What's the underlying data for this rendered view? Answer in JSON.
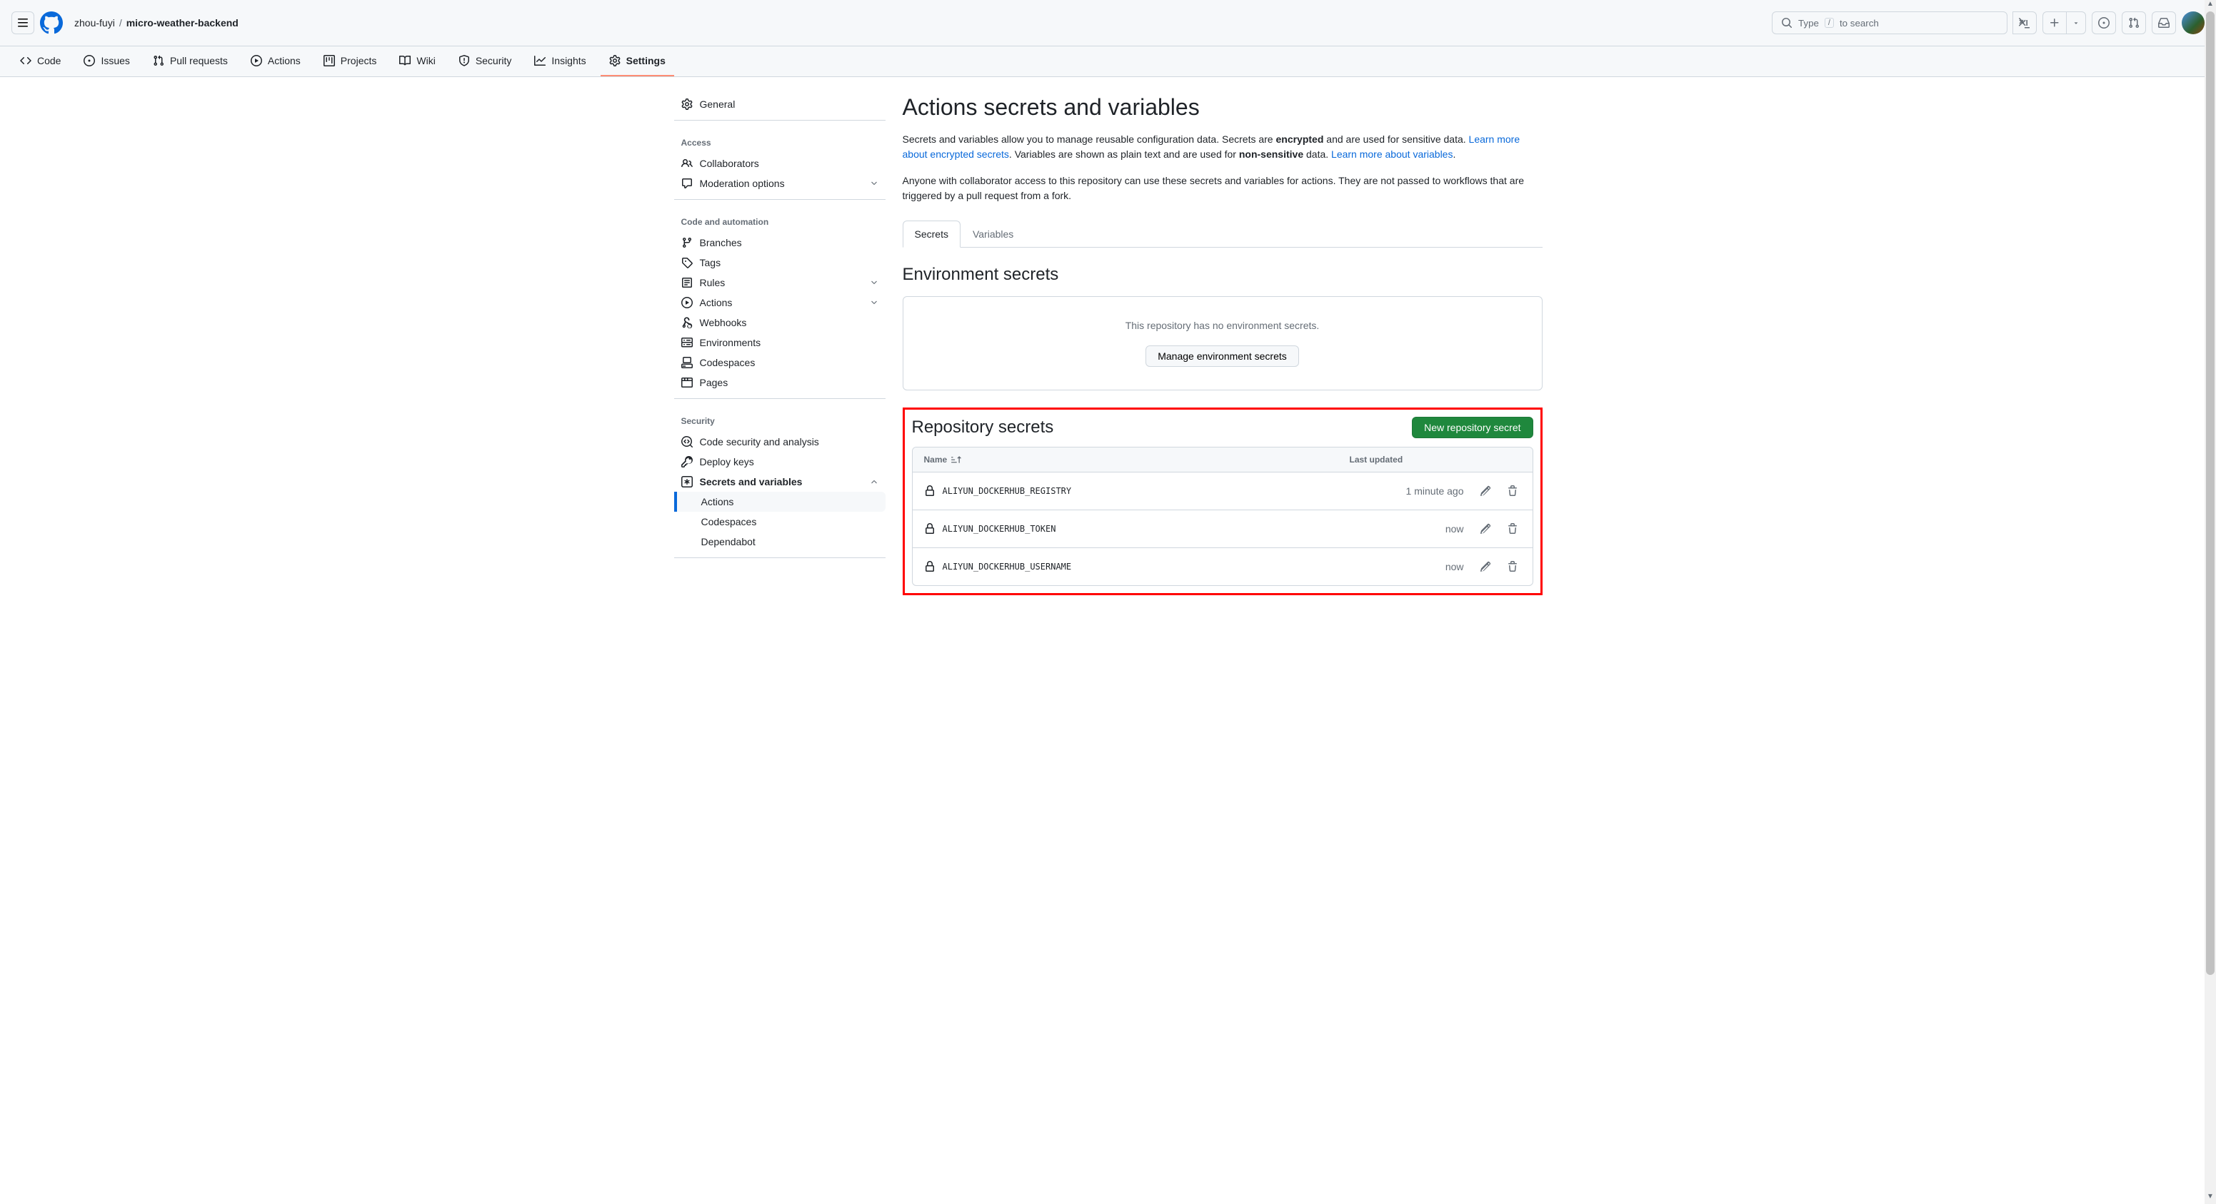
{
  "header": {
    "owner": "zhou-fuyi",
    "repo": "micro-weather-backend",
    "search_prefix": "Type",
    "search_key": "/",
    "search_suffix": "to search"
  },
  "repo_nav": {
    "code": "Code",
    "issues": "Issues",
    "pulls": "Pull requests",
    "actions": "Actions",
    "projects": "Projects",
    "wiki": "Wiki",
    "security": "Security",
    "insights": "Insights",
    "settings": "Settings"
  },
  "sidebar": {
    "general": "General",
    "access_heading": "Access",
    "collaborators": "Collaborators",
    "moderation": "Moderation options",
    "code_heading": "Code and automation",
    "branches": "Branches",
    "tags": "Tags",
    "rules": "Rules",
    "actions": "Actions",
    "webhooks": "Webhooks",
    "environments": "Environments",
    "codespaces": "Codespaces",
    "pages": "Pages",
    "security_heading": "Security",
    "code_security": "Code security and analysis",
    "deploy_keys": "Deploy keys",
    "secrets_vars": "Secrets and variables",
    "sub_actions": "Actions",
    "sub_codespaces": "Codespaces",
    "sub_dependabot": "Dependabot"
  },
  "main": {
    "title": "Actions secrets and variables",
    "intro1a": "Secrets and variables allow you to manage reusable configuration data. Secrets are ",
    "intro1b": "encrypted",
    "intro1c": " and are used for sensitive data. ",
    "learn_secrets": "Learn more about encrypted secrets",
    "intro1d": ". Variables are shown as plain text and are used for ",
    "intro1e": "non-sensitive",
    "intro1f": " data. ",
    "learn_vars": "Learn more about variables",
    "intro1g": ".",
    "intro2": "Anyone with collaborator access to this repository can use these secrets and variables for actions. They are not passed to workflows that are triggered by a pull request from a fork.",
    "tab_secrets": "Secrets",
    "tab_variables": "Variables",
    "env_title": "Environment secrets",
    "env_empty": "This repository has no environment secrets.",
    "env_btn": "Manage environment secrets",
    "repo_title": "Repository secrets",
    "new_btn": "New repository secret",
    "col_name": "Name",
    "col_updated": "Last updated",
    "secrets": [
      {
        "name": "ALIYUN_DOCKERHUB_REGISTRY",
        "updated": "1 minute ago"
      },
      {
        "name": "ALIYUN_DOCKERHUB_TOKEN",
        "updated": "now"
      },
      {
        "name": "ALIYUN_DOCKERHUB_USERNAME",
        "updated": "now"
      }
    ]
  }
}
